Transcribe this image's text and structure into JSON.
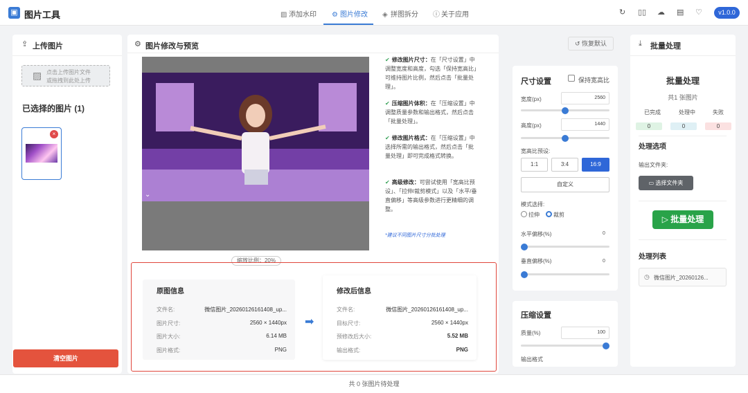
{
  "app": {
    "title": "图片工具",
    "version": "v1.0.0",
    "logo_icon": "image-tool-logo-icon"
  },
  "tabs": [
    {
      "label": "添加水印",
      "icon": "image-icon"
    },
    {
      "label": "图片修改",
      "icon": "gear-icon"
    },
    {
      "label": "拼图拆分",
      "icon": "layers-icon"
    },
    {
      "label": "关于应用",
      "icon": "info-icon"
    }
  ],
  "header_icons": [
    "refresh-icon",
    "book-icon",
    "cloud-icon",
    "document-icon",
    "heart-icon"
  ],
  "upload": {
    "title": "上传图片",
    "box_line1": "点击上传图片文件",
    "box_line2": "或拖拽到此处上传",
    "selected_title": "已选择的图片 (1)",
    "clear_button": "清空图片"
  },
  "preview": {
    "title": "图片修改与预览",
    "restore_button": "恢复默认",
    "scale_label": "缩放比例：20%"
  },
  "guide": {
    "items": [
      {
        "title": "修改图片尺寸：",
        "text": "在「尺寸设置」中调整宽度和高度，勾选「保持宽高比」可维持图片比例，然后点击「批量处理」。"
      },
      {
        "title": "压缩图片体积：",
        "text": "在「压缩设置」中调整质量参数和输出格式，然后点击「批量处理」。"
      },
      {
        "title": "修改图片格式：",
        "text": "在「压缩设置」中选择所需的输出格式，然后点击「批量处理」即可完成格式转换。"
      },
      {
        "title": "高级修改：",
        "text": "可尝试使用「宽高比预设」、「拉伸/裁剪模式」以及「水平/垂直偏移」等高级参数进行更精细的调整。"
      }
    ],
    "note": "*建议不同图片尺寸分批处理"
  },
  "original_info": {
    "title": "原图信息",
    "rows": [
      {
        "label": "文件名:",
        "value": "微信图片_20260126161408_up..."
      },
      {
        "label": "图片尺寸:",
        "value": "2560 × 1440px"
      },
      {
        "label": "图片大小:",
        "value": "6.14 MB"
      },
      {
        "label": "图片格式:",
        "value": "PNG"
      }
    ]
  },
  "modified_info": {
    "title": "修改后信息",
    "rows": [
      {
        "label": "文件名:",
        "value": "微信图片_20260126161408_up..."
      },
      {
        "label": "目标尺寸:",
        "value": "2560 × 1440px"
      },
      {
        "label": "预修改后大小:",
        "value": "5.52 MB"
      },
      {
        "label": "输出格式:",
        "value": "PNG"
      }
    ]
  },
  "size_settings": {
    "title": "尺寸设置",
    "keep_ratio_label": "保持宽高比",
    "keep_ratio_checked": false,
    "width_label": "宽度(px)",
    "width_value": "2560",
    "width_slider_fraction": 0.5,
    "height_label": "高度(px)",
    "height_value": "1440",
    "height_slider_fraction": 0.5,
    "ratio_preset_label": "宽高比预设:",
    "ratio_buttons": [
      "1:1",
      "3:4",
      "16:9"
    ],
    "ratio_selected": "16:9",
    "custom_button": "自定义",
    "mode_label": "模式选择:",
    "mode_options": [
      "拉伸",
      "裁剪"
    ],
    "mode_selected": "裁剪",
    "h_offset_label": "水平偏移(%)",
    "h_offset_value": "0",
    "v_offset_label": "垂直偏移(%)",
    "v_offset_value": "0"
  },
  "compress_settings": {
    "title": "压缩设置",
    "quality_label": "质量(%)",
    "quality_value": "100",
    "quality_slider_fraction": 1.0,
    "output_format_label": "输出格式"
  },
  "batch": {
    "title": "批量处理",
    "heading": "批量处理",
    "count_text": "共1 张图片",
    "stats": [
      {
        "label": "已完成",
        "value": "0",
        "color": "#dff3e4"
      },
      {
        "label": "处理中",
        "value": "0",
        "color": "#dff0f5"
      },
      {
        "label": "失败",
        "value": "0",
        "color": "#fbe1e1"
      }
    ],
    "options_title": "处理选项",
    "output_folder_label": "输出文件夹:",
    "open_folder_button": "选择文件夹",
    "batch_button": "批量处理",
    "list_title": "处理列表",
    "list_items": [
      "微信图片_20260126..."
    ]
  },
  "status_bar": {
    "text": "共 0 张图片待处理"
  }
}
